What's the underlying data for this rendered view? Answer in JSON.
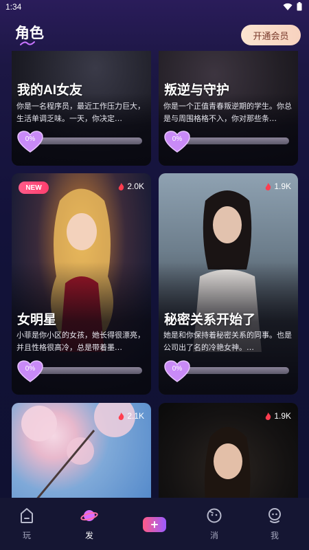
{
  "status_bar": {
    "time": "1:34"
  },
  "header": {
    "title": "角色",
    "vip_button": "开通会员"
  },
  "cards": [
    {
      "title": "我的AI女友",
      "description": "你是一名程序员，最近工作压力巨大，生活单调乏味。一天，你决定…",
      "progress": "0%"
    },
    {
      "title": "叛逆与守护",
      "description": "你是一个正值青春叛逆期的学生。你总是与周围格格不入，你对那些条…",
      "progress": "0%"
    },
    {
      "title": "女明星",
      "badge": "NEW",
      "likes": "2.0K",
      "description": "小菲是你小区的女孩，她长得很漂亮，并且性格很高冷，总是带着墨…",
      "progress": "0%"
    },
    {
      "title": "秘密关系开始了",
      "likes": "1.9K",
      "description": "她是和你保持着秘密关系的同事。也是公司出了名的冷艳女神。…",
      "progress": "0%"
    },
    {
      "likes": "2.1K"
    },
    {
      "likes": "1.9K"
    }
  ],
  "tabbar": {
    "tabs": [
      "玩",
      "发",
      "消",
      "我"
    ],
    "active": "发"
  },
  "colors": {
    "accent_pink": "#ff5b86",
    "accent_purple": "#9b5cff",
    "background": "#13123a"
  }
}
